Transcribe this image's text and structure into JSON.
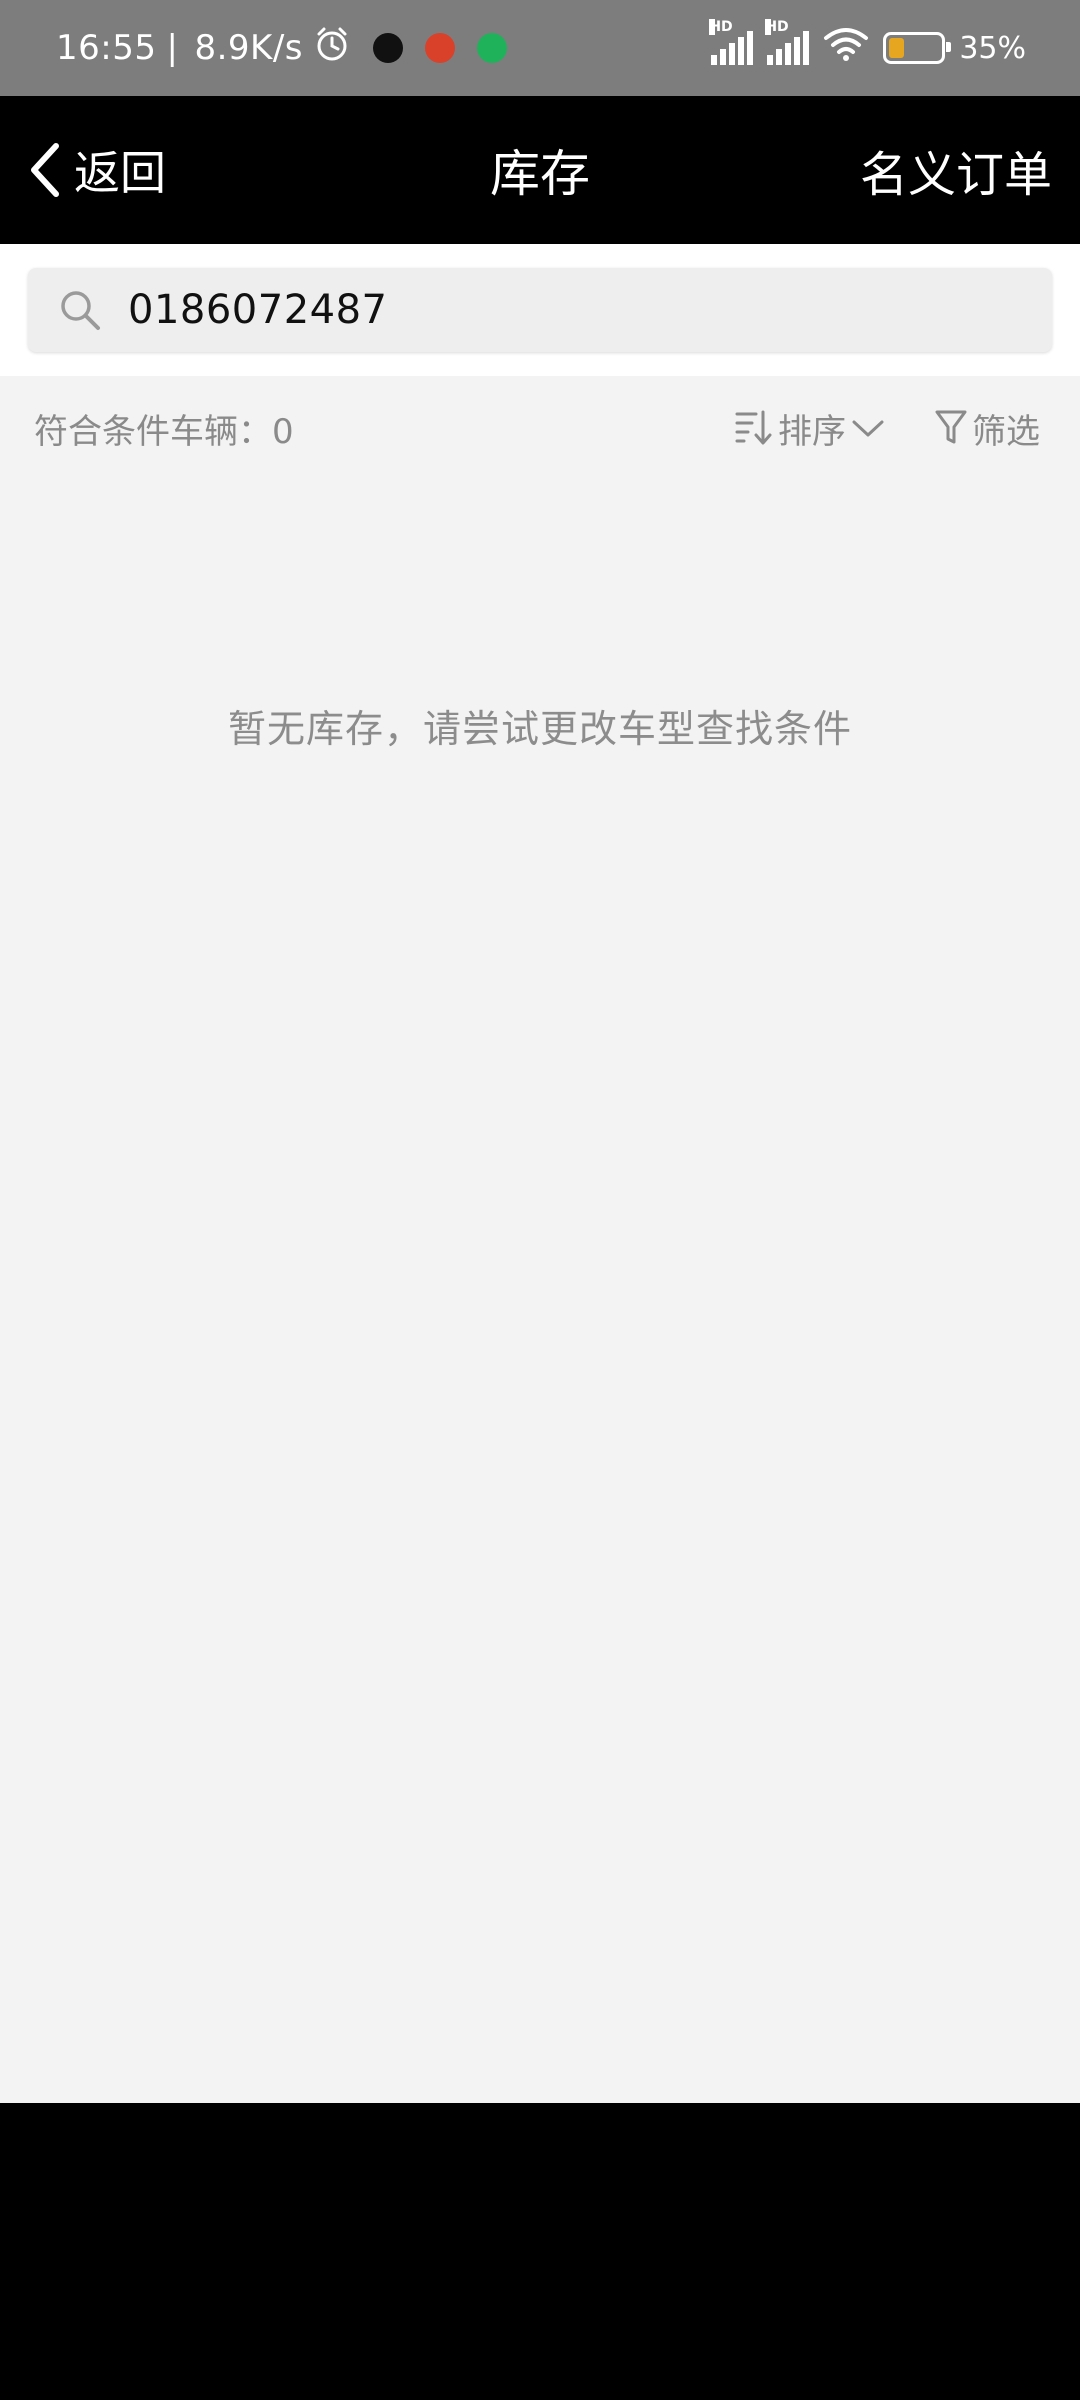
{
  "status_bar": {
    "time": "16:55",
    "separator": "|",
    "net_speed": "8.9K/s",
    "battery_text": "35%",
    "battery_level": 0.35,
    "signal_label_1": "HD",
    "signal_label_2": "HD"
  },
  "nav": {
    "back_label": "返回",
    "title": "库存",
    "right_label": "名义订单"
  },
  "search": {
    "value": "0186072487"
  },
  "filter_bar": {
    "count_label": "符合条件车辆：0",
    "sort_label": "排序",
    "filter_label": "筛选"
  },
  "empty_state": {
    "message": "暂无库存，请尝试更改车型查找条件"
  },
  "colors": {
    "status_bar_bg": "#7d7d7d",
    "nav_bg": "#000000",
    "content_bg": "#f3f3f3",
    "muted_text": "#8a8a8a",
    "battery_fill": "#e7a61f"
  }
}
